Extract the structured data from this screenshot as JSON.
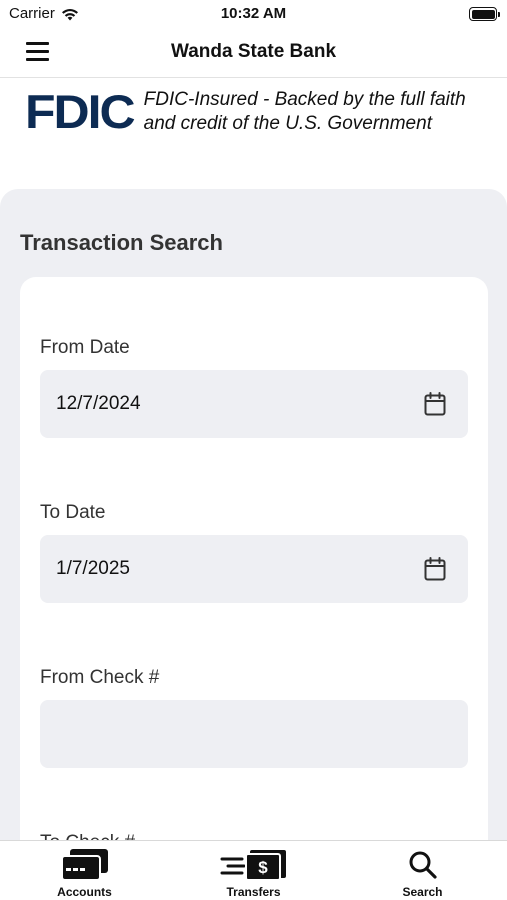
{
  "status_bar": {
    "carrier": "Carrier",
    "time": "10:32 AM"
  },
  "nav": {
    "title": "Wanda State Bank",
    "menu_icon": "hamburger-menu-icon"
  },
  "fdic": {
    "logo_text": "FDIC",
    "line1": "FDIC-Insured - Backed by the full faith",
    "line2": "and credit of the U.S. Government",
    "logo_color": "#0d2b53"
  },
  "search": {
    "title": "Transaction Search",
    "fields": [
      {
        "label": "From Date",
        "value": "12/7/2024",
        "icon": "calendar-icon"
      },
      {
        "label": "To Date",
        "value": "1/7/2025",
        "icon": "calendar-icon"
      },
      {
        "label": "From Check #",
        "value": ""
      },
      {
        "label": "To Check #",
        "value": ""
      }
    ]
  },
  "tabs": [
    {
      "label": "Accounts",
      "icon": "credit-card-icon"
    },
    {
      "label": "Transfers",
      "icon": "money-transfer-icon"
    },
    {
      "label": "Search",
      "icon": "search-icon"
    }
  ],
  "colors": {
    "panel_bg": "#eeeff3",
    "field_bg": "#eeeff3",
    "card_bg": "#ffffff"
  }
}
